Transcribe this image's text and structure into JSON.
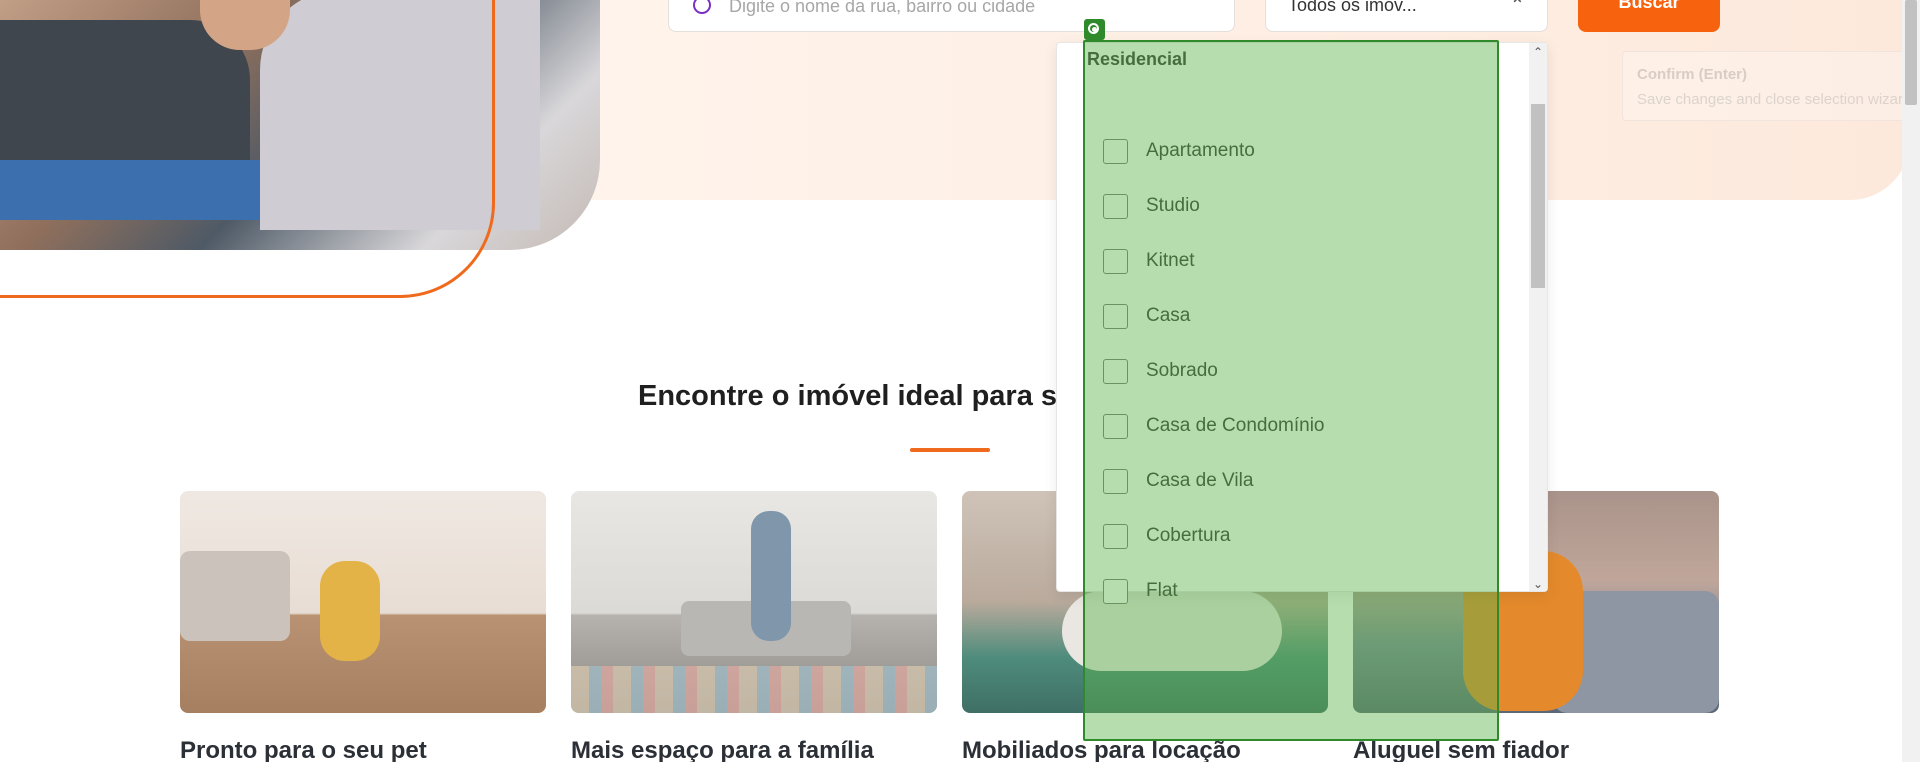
{
  "search": {
    "placeholder": "Digite o nome da rua, bairro ou cidade"
  },
  "type_select": {
    "value": "Todos os imóv..."
  },
  "buscar_label": "Buscar",
  "hint": {
    "title": "Confirm (Enter)",
    "text": "Save changes and close selection wizard"
  },
  "section": {
    "title": "Encontre o imóvel ideal para se"
  },
  "cards": [
    {
      "title": "Pronto para o seu pet"
    },
    {
      "title": "Mais espaço para a família"
    },
    {
      "title": "Mobiliados para locação"
    },
    {
      "title": "Aluguel sem fiador"
    }
  ],
  "dropdown": {
    "group_label": "Residencial",
    "items": [
      {
        "label": "Apartamento",
        "checked": false
      },
      {
        "label": "Studio",
        "checked": false
      },
      {
        "label": "Kitnet",
        "checked": false
      },
      {
        "label": "Casa",
        "checked": false
      },
      {
        "label": "Sobrado",
        "checked": false
      },
      {
        "label": "Casa de Condomínio",
        "checked": false
      },
      {
        "label": "Casa de Vila",
        "checked": false
      },
      {
        "label": "Cobertura",
        "checked": false
      },
      {
        "label": "Flat",
        "checked": false
      }
    ]
  },
  "colors": {
    "accent": "#f7620f",
    "highlight": "#5cb44c",
    "search_icon": "#7a2fc2"
  }
}
